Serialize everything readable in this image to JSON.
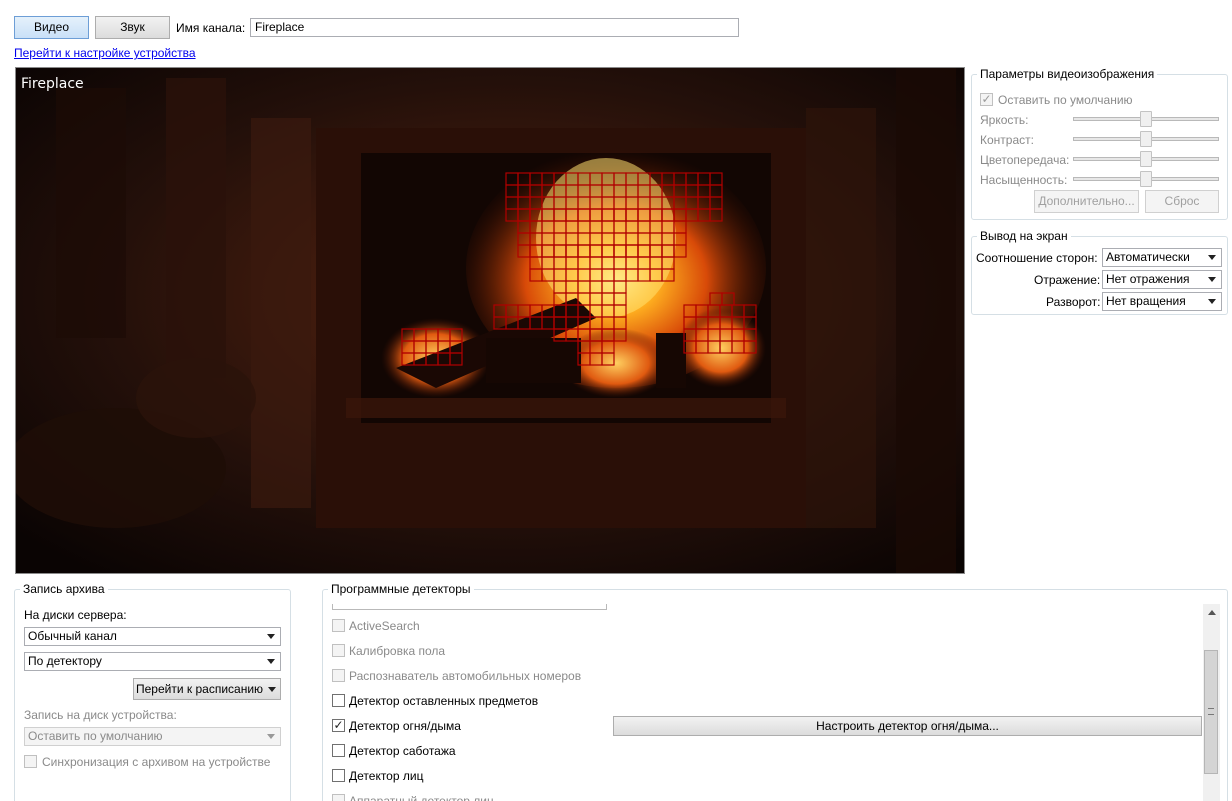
{
  "top": {
    "tab_video": "Видео",
    "tab_sound": "Звук",
    "channel_name_label": "Имя канала:",
    "channel_name_value": "Fireplace",
    "device_settings_link": "Перейти к настройке устройства"
  },
  "video": {
    "overlay_title": "Fireplace"
  },
  "image_params": {
    "title": "Параметры видеоизображения",
    "keep_default_label": "Оставить по умолчанию",
    "keep_default_checked": true,
    "brightness_label": "Яркость:",
    "contrast_label": "Контраст:",
    "color_label": "Цветопередача:",
    "saturation_label": "Насыщенность:",
    "brightness": 0.5,
    "contrast": 0.5,
    "color": 0.5,
    "saturation": 0.5,
    "advanced_button": "Дополнительно...",
    "reset_button": "Сброс"
  },
  "display": {
    "title": "Вывод на экран",
    "aspect_label": "Соотношение сторон:",
    "aspect_value": "Автоматически",
    "mirror_label": "Отражение:",
    "mirror_value": "Нет отражения",
    "rotate_label": "Разворот:",
    "rotate_value": "Нет вращения"
  },
  "archive": {
    "title": "Запись архива",
    "server_disks_label": "На диски сервера:",
    "channel_type_value": "Обычный канал",
    "record_mode_value": "По детектору",
    "schedule_button": "Перейти к расписанию",
    "device_disk_label": "Запись на диск устройства:",
    "device_disk_value": "Оставить по умолчанию",
    "sync_label": "Синхронизация с архивом на устройстве"
  },
  "detectors": {
    "title": "Программные детекторы",
    "items": [
      {
        "label": "ActiveSearch",
        "enabled": false,
        "checked": false
      },
      {
        "label": "Калибровка пола",
        "enabled": false,
        "checked": false
      },
      {
        "label": "Распознаватель автомобильных номеров",
        "enabled": false,
        "checked": false
      },
      {
        "label": "Детектор оставленных предметов",
        "enabled": true,
        "checked": false
      },
      {
        "label": "Детектор огня/дыма",
        "enabled": true,
        "checked": true
      },
      {
        "label": "Детектор саботажа",
        "enabled": true,
        "checked": false
      },
      {
        "label": "Детектор лиц",
        "enabled": true,
        "checked": false
      },
      {
        "label": "Аппаратный детектор лиц",
        "enabled": false,
        "checked": false
      }
    ],
    "configure_fire_button": "Настроить детектор огня/дыма..."
  },
  "colors": {
    "accent": "#c9e0f7",
    "detection_grid": "#b00000",
    "link": "#0000ee"
  }
}
